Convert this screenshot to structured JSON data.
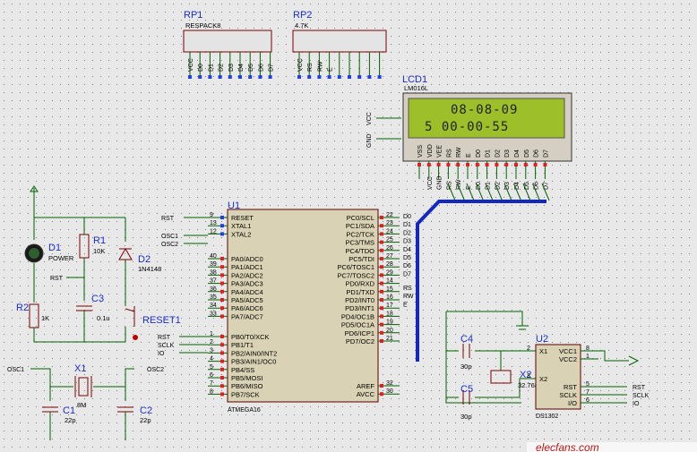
{
  "rp1": {
    "ref": "RP1",
    "value": "RESPACK8",
    "pins": [
      "VCC",
      "D0",
      "D1",
      "D2",
      "D3",
      "D4",
      "D5",
      "D6",
      "D7"
    ]
  },
  "rp2": {
    "ref": "RP2",
    "value": "4.7K",
    "pins": [
      "VCC",
      "RS",
      "RW",
      "E",
      "",
      "",
      "",
      "",
      ""
    ]
  },
  "lcd": {
    "ref": "LCD1",
    "value": "LM016L",
    "line1": "08-08-09",
    "line2": "5  00-00-55",
    "pins": [
      "VSS",
      "VDD",
      "VEE",
      "RS",
      "RW",
      "E",
      "D0",
      "D1",
      "D2",
      "D3",
      "D4",
      "D5",
      "D6",
      "D7"
    ],
    "nets": [
      "VCC",
      "GND",
      "RS",
      "RW",
      "E",
      "D0",
      "D1",
      "D2",
      "D3",
      "D4",
      "D5",
      "D6",
      "D7"
    ]
  },
  "u1": {
    "ref": "U1",
    "value": "ATMEGA16",
    "left": [
      [
        "9",
        "RESET"
      ],
      [
        "13",
        "XTAL1"
      ],
      [
        "12",
        "XTAL2"
      ],
      [
        "40",
        "PA0/ADC0"
      ],
      [
        "39",
        "PA1/ADC1"
      ],
      [
        "38",
        "PA2/ADC2"
      ],
      [
        "37",
        "PA3/ADC3"
      ],
      [
        "36",
        "PA4/ADC4"
      ],
      [
        "35",
        "PA5/ADC5"
      ],
      [
        "34",
        "PA6/ADC6"
      ],
      [
        "33",
        "PA7/ADC7"
      ],
      [
        "1",
        "PB0/T0/XCK"
      ],
      [
        "2",
        "PB1/T1"
      ],
      [
        "3",
        "PB2/AIN0/INT2"
      ],
      [
        "4",
        "PB3/AIN1/OC0"
      ],
      [
        "5",
        "PB4/SS"
      ],
      [
        "6",
        "PB5/MOSI"
      ],
      [
        "7",
        "PB6/MISO"
      ],
      [
        "8",
        "PB7/SCK"
      ]
    ],
    "right": [
      [
        "22",
        "PC0/SCL"
      ],
      [
        "23",
        "PC1/SDA"
      ],
      [
        "24",
        "PC2/TCK"
      ],
      [
        "25",
        "PC3/TMS"
      ],
      [
        "26",
        "PC4/TDO"
      ],
      [
        "27",
        "PC5/TDI"
      ],
      [
        "28",
        "PC6/TOSC1"
      ],
      [
        "29",
        "PC7/TOSC2"
      ],
      [
        "14",
        "PD0/RXD"
      ],
      [
        "15",
        "PD1/TXD"
      ],
      [
        "16",
        "PD2/INT0"
      ],
      [
        "17",
        "PD3/INT1"
      ],
      [
        "18",
        "PD4/OC1B"
      ],
      [
        "19",
        "PD5/OC1A"
      ],
      [
        "20",
        "PD6/ICP1"
      ],
      [
        "21",
        "PD7/OC2"
      ],
      [
        "32",
        "AREF"
      ],
      [
        "30",
        "AVCC"
      ]
    ],
    "left_nets": [
      "RST",
      "OSC1",
      "OSC2"
    ],
    "pb_nets": [
      "RST",
      "SCLK",
      "IO"
    ],
    "right_nets": [
      "D0",
      "D1",
      "D2",
      "D3",
      "D4",
      "D5",
      "D6",
      "D7",
      "RS",
      "RW",
      "E"
    ]
  },
  "d1": {
    "ref": "D1",
    "value": "POWER"
  },
  "r1": {
    "ref": "R1",
    "value": "10K"
  },
  "d2": {
    "ref": "D2",
    "value": "1N4148"
  },
  "r2": {
    "ref": "R2",
    "value": "1K"
  },
  "c3": {
    "ref": "C3",
    "value": "0.1u"
  },
  "reset": {
    "ref": "RESET1",
    "net": "RST"
  },
  "x1": {
    "ref": "X1",
    "value": "8M"
  },
  "c1": {
    "ref": "C1",
    "value": "22p"
  },
  "c2": {
    "ref": "C2",
    "value": "22p"
  },
  "osc": {
    "a": "OSC1",
    "b": "OSC2"
  },
  "c4": {
    "ref": "C4",
    "value": "30p"
  },
  "c5": {
    "ref": "C5",
    "value": "30p"
  },
  "x2": {
    "ref": "X2",
    "value": "32.768"
  },
  "u2": {
    "ref": "U2",
    "value": "DS1302",
    "pins": [
      [
        "2",
        "X1"
      ],
      [
        "3",
        "X2"
      ],
      [
        "8",
        "VCC1"
      ],
      [
        "1",
        "VCC2"
      ],
      [
        "5",
        "RST"
      ],
      [
        "7",
        "SCLK"
      ],
      [
        "6",
        "I/O"
      ]
    ],
    "nets": [
      "RST",
      "SCLK",
      "IO"
    ]
  },
  "watermark": "elecfans.com"
}
